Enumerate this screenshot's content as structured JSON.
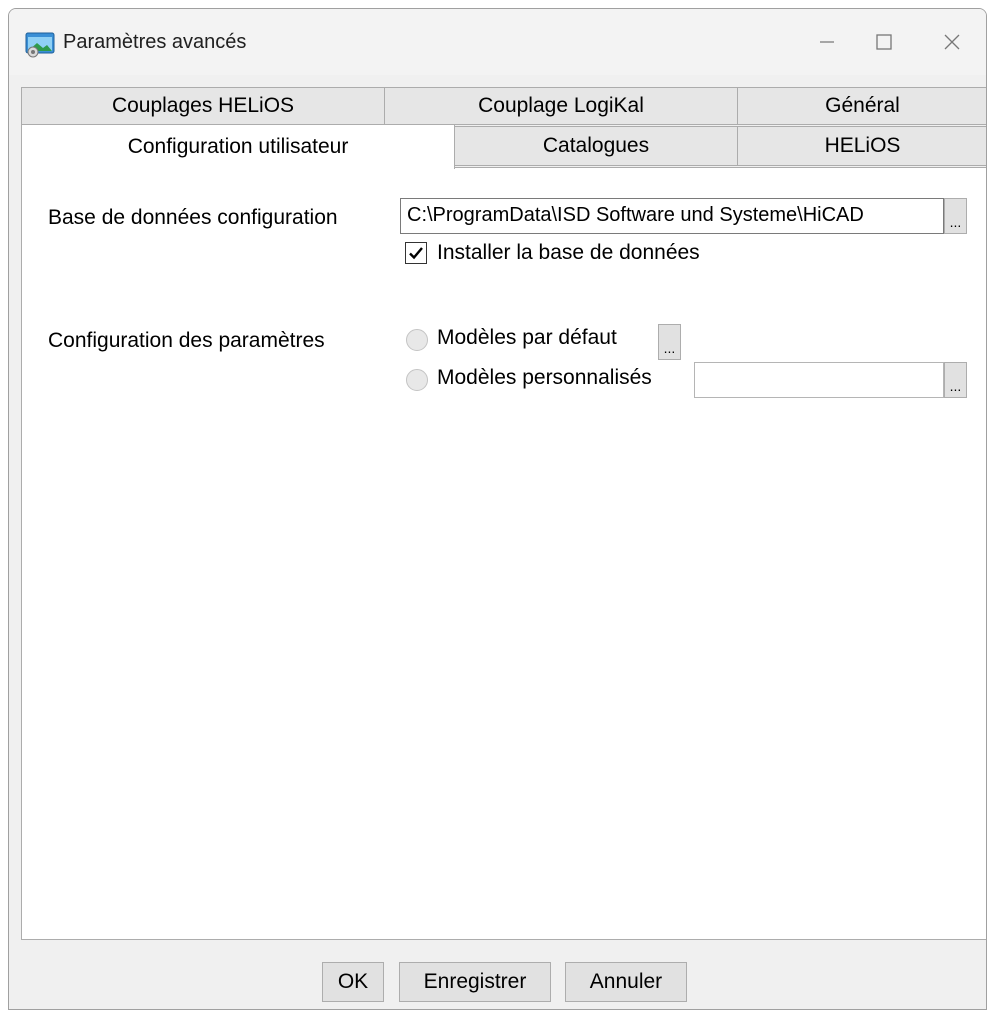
{
  "window": {
    "title": "Paramètres avancés",
    "icon": "app-window-icon",
    "controls": {
      "minimize": "minimize-icon",
      "maximize": "maximize-icon",
      "close": "close-icon"
    }
  },
  "tabs": {
    "row1": [
      "Couplages HELiOS",
      "Couplage LogiKal",
      "Général"
    ],
    "row2": [
      "Configuration utilisateur",
      "Catalogues",
      "HELiOS"
    ],
    "active": "Configuration utilisateur"
  },
  "config": {
    "db_label": "Base de données configuration",
    "db_path": "C:\\ProgramData\\ISD Software und Systeme\\HiCAD",
    "browse_label": "...",
    "install_db_label": "Installer la base de données",
    "install_db_checked": true,
    "params_label": "Configuration des paramètres",
    "default_models_label": "Modèles par défaut",
    "custom_models_label": "Modèles personnalisés",
    "custom_models_value": ""
  },
  "buttons": {
    "ok": "OK",
    "save": "Enregistrer",
    "cancel": "Annuler"
  },
  "colors": {
    "accent": "#0078d7",
    "window_bg": "#f0f0f0",
    "panel_bg": "#ffffff",
    "tab_bg": "#e6e6e6"
  }
}
